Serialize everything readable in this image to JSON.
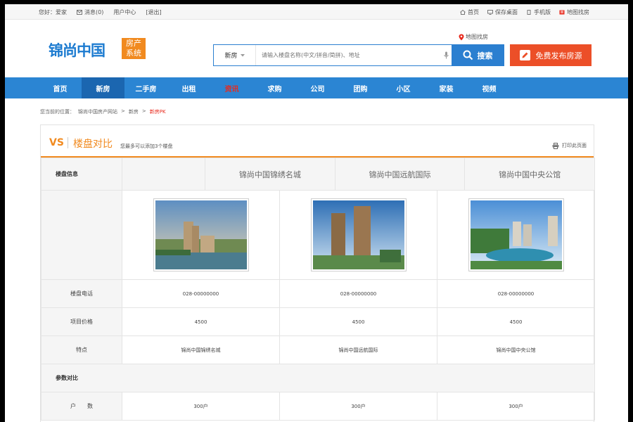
{
  "topbar": {
    "greeting": "您好：爱家",
    "messages": "消息(0)",
    "user_center": "用户中心",
    "logout": "[退出]",
    "home": "首页",
    "save_desktop": "保存桌面",
    "mobile": "手机版",
    "map_search": "地图找房"
  },
  "logo": {
    "main": "锦尚中国",
    "tag_line1": "房产",
    "tag_line2": "系统"
  },
  "map_locate": "地图找房",
  "search": {
    "category": "新房",
    "placeholder": "请输入楼盘名称(中文/拼音/简拼)、地址",
    "button": "搜索"
  },
  "publish_button": "免费发布房源",
  "nav": [
    "首页",
    "新房",
    "二手房",
    "出租",
    "资讯",
    "求购",
    "公司",
    "团购",
    "小区",
    "家装",
    "视频"
  ],
  "nav_active_index": 1,
  "nav_hot_index": 4,
  "breadcrumb": {
    "prefix": "您当前的位置：",
    "site": "锦尚中国房产网站",
    "sep": ">",
    "section": "新房",
    "current": "新房PK"
  },
  "compare": {
    "vs": "VS",
    "title": "楼盘对比",
    "hint": "您最多可以添加3个楼盘",
    "print": "打印此页面",
    "info_label": "楼盘信息",
    "estates": [
      {
        "name": "锦尚中国锦绣名城",
        "phone": "028-00000000",
        "price": "4500",
        "feature": "锦尚中国锦绣名城",
        "units": "300户"
      },
      {
        "name": "锦尚中国远航国际",
        "phone": "028-00000000",
        "price": "4500",
        "feature": "锦尚中国远航国际",
        "units": "300户"
      },
      {
        "name": "锦尚中国中央公馆",
        "phone": "028-00000000",
        "price": "4500",
        "feature": "锦尚中国中央公馆",
        "units": "300户"
      }
    ],
    "labels": {
      "phone": "楼盘电话",
      "price": "项目价格",
      "feature": "特点",
      "params": "参数对比",
      "units": "户　　数"
    }
  },
  "colors": {
    "brand_blue": "#2b85d3",
    "accent_orange": "#f18a1f",
    "publish_red": "#ec4f28",
    "hot_red": "#e8291c"
  }
}
